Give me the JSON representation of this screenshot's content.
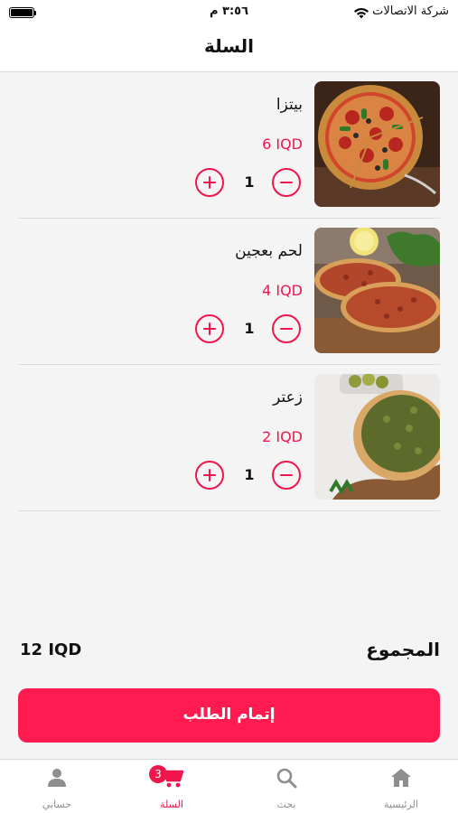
{
  "status_bar": {
    "carrier": "شركة الاتصالات",
    "time": "٣:٥٦ م"
  },
  "header": {
    "title": "السلة"
  },
  "cart": {
    "items": [
      {
        "name": "بيتزا",
        "price": "6 IQD",
        "quantity": "1",
        "image": "pizza"
      },
      {
        "name": "لحم بعجين",
        "price": "4 IQD",
        "quantity": "1",
        "image": "lahm-bi-ajeen"
      },
      {
        "name": "زعتر",
        "price": "2 IQD",
        "quantity": "1",
        "image": "zaatar-manakish"
      }
    ]
  },
  "summary": {
    "total_label": "المجموع",
    "total_value": "12 IQD"
  },
  "checkout": {
    "label": "إتمام الطلب"
  },
  "tab_bar": {
    "tabs": [
      {
        "label": "الرئيسية",
        "icon": "home-icon"
      },
      {
        "label": "بحث",
        "icon": "search-icon"
      },
      {
        "label": "السلة",
        "icon": "cart-icon",
        "badge": "3",
        "active": true
      },
      {
        "label": "حسابي",
        "icon": "person-icon"
      }
    ]
  },
  "colors": {
    "accent": "#f0154d",
    "button": "#ff1a4f",
    "inactive_tab": "#8e8e8e"
  }
}
